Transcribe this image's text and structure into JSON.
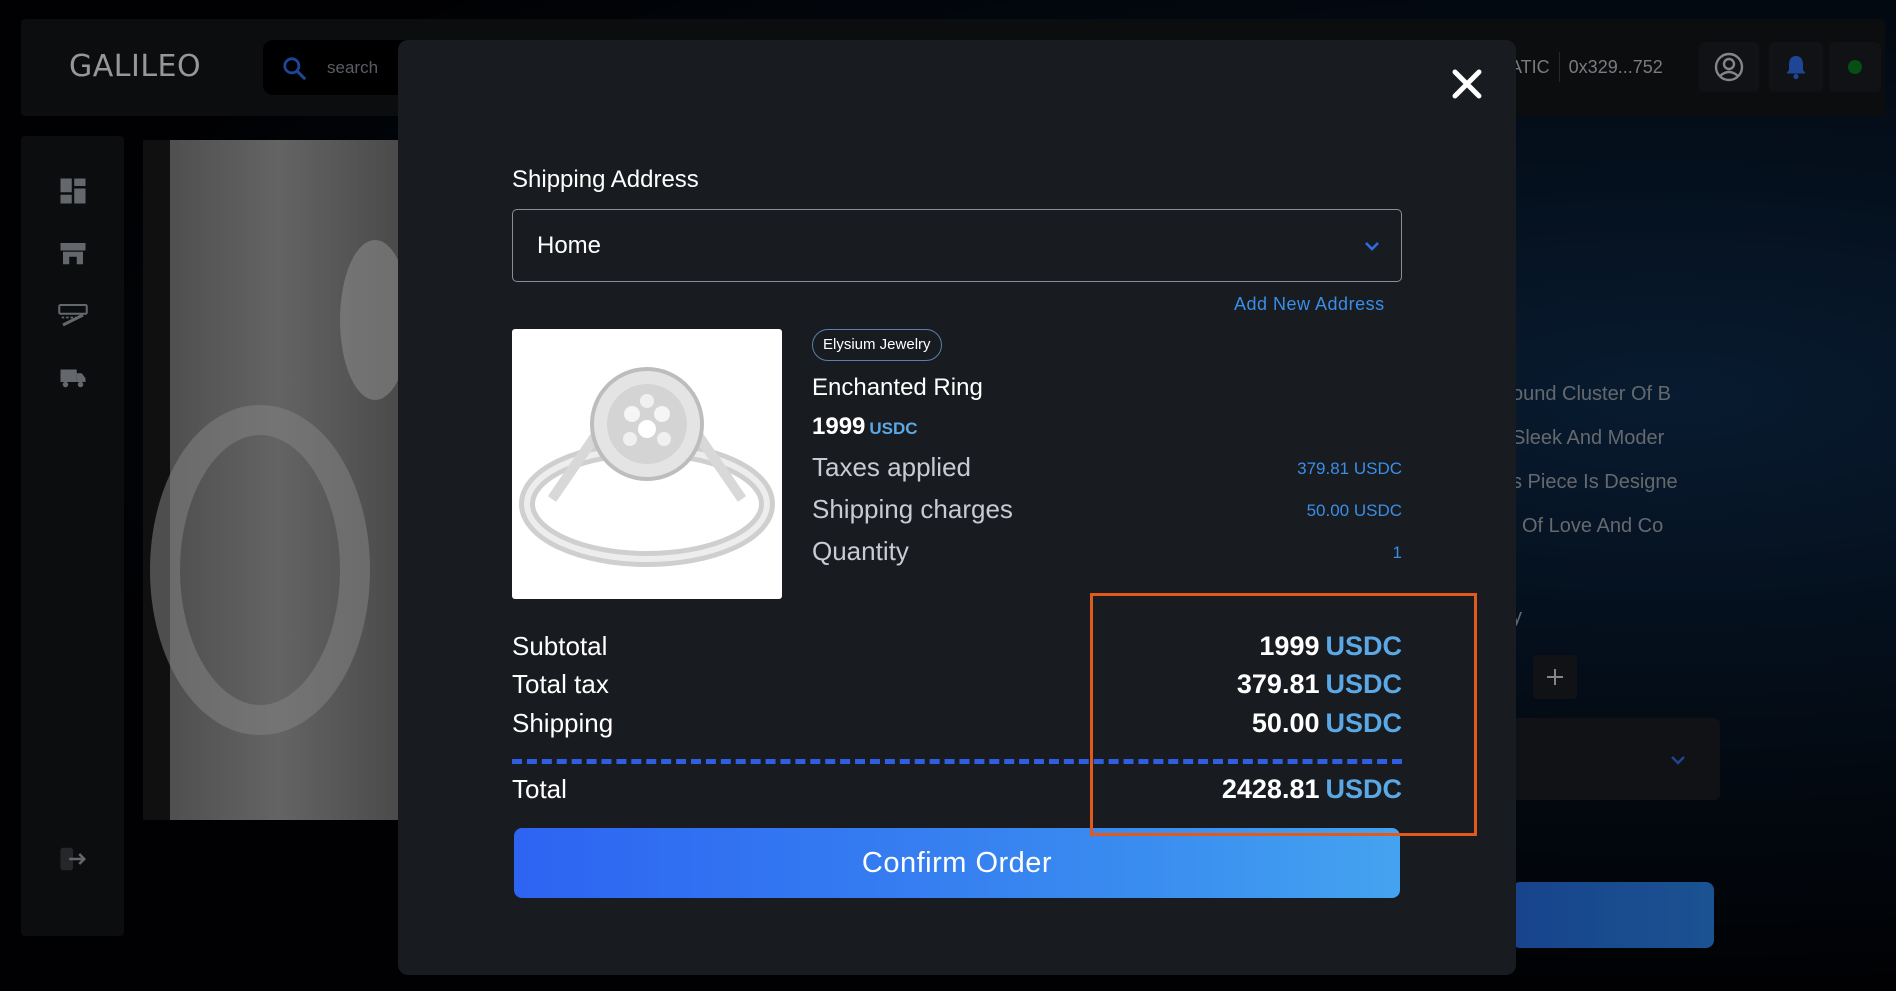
{
  "app": {
    "logo": "GALILEO",
    "search_placeholder": "search"
  },
  "header": {
    "network": "ATIC",
    "wallet_address": "0x329...752"
  },
  "background": {
    "description_lines": [
      "ound Cluster Of B",
      "Sleek And Moder",
      "s Piece Is Designe",
      "l Of Love And Co"
    ],
    "partial_char": "y"
  },
  "modal": {
    "shipping_label": "Shipping Address",
    "selected_address": "Home",
    "add_address_label": "Add New Address",
    "product": {
      "brand": "Elysium Jewelry",
      "name": "Enchanted Ring",
      "price": "1999",
      "price_unit": "USDC",
      "details": [
        {
          "label": "Taxes applied",
          "value": "379.81 USDC"
        },
        {
          "label": "Shipping charges",
          "value": "50.00 USDC"
        },
        {
          "label": "Quantity",
          "value": "1"
        }
      ]
    },
    "summary": {
      "subtotal_label": "Subtotal",
      "subtotal_value": "1999",
      "tax_label": "Total tax",
      "tax_value": "379.81",
      "shipping_label": "Shipping",
      "shipping_value": "50.00",
      "total_label": "Total",
      "total_value": "2428.81",
      "currency": "USDC"
    },
    "confirm_label": "Confirm Order"
  },
  "colors": {
    "accent_blue": "#3a8ee8",
    "highlight_orange": "#e05a1e",
    "modal_bg": "#181b1f"
  }
}
